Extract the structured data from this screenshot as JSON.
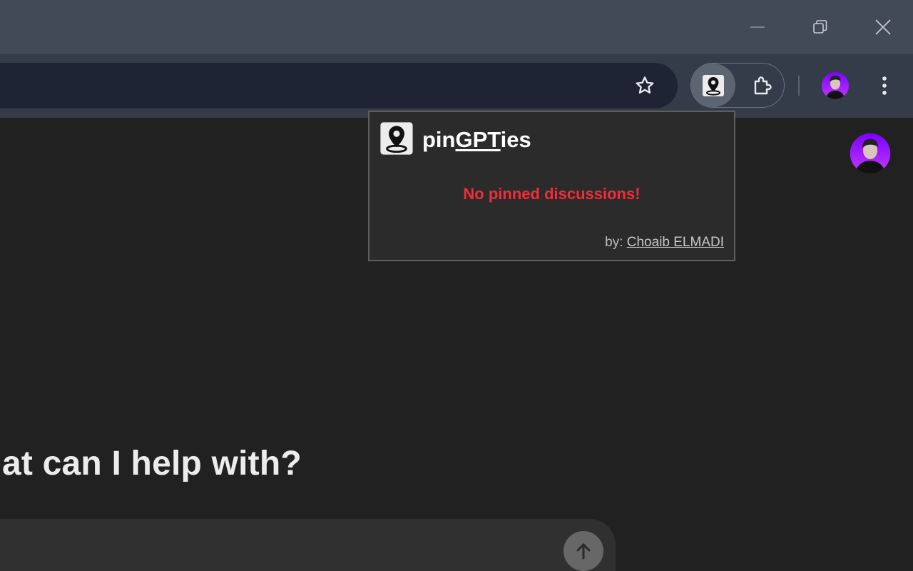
{
  "window": {
    "minimize_icon": "minimize-icon",
    "restore_icon": "restore-icon",
    "close_icon": "close-icon"
  },
  "toolbar": {
    "bookmark_icon": "star-icon",
    "extension_icon": "map-pin-icon",
    "extensions_menu_icon": "puzzle-icon",
    "profile": "avatar",
    "menu_icon": "kebab-menu-icon"
  },
  "page": {
    "heading": "What can I help with?",
    "send_icon": "arrow-up-icon"
  },
  "popup": {
    "title_prefix": "pin",
    "title_underlined": "GPT",
    "title_suffix": "ies",
    "empty_message": "No pinned discussions!",
    "credit_prefix": "by:",
    "credit_author": "Choaib ELMADI"
  },
  "colors": {
    "titlebar": "#434a57",
    "toolbar": "#353c49",
    "omnibox": "#1e2433",
    "page_bg": "#212121",
    "composer": "#303030",
    "popup_bg": "#2b2b2b",
    "popup_border": "#5f5f5f",
    "error_red": "#ef2e3a",
    "avatar_purple": "#9b1fff"
  }
}
